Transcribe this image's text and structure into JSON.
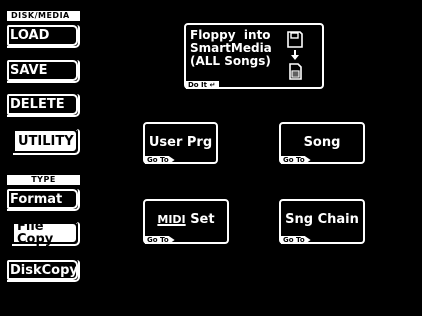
{
  "sidebar": {
    "header": "DISK/MEDIA",
    "items": [
      {
        "label": "LOAD"
      },
      {
        "label": "SAVE"
      },
      {
        "label": "DELETE"
      },
      {
        "label": "UTILITY"
      }
    ],
    "type_header": "TYPE",
    "type_items": [
      {
        "label": "Format"
      },
      {
        "label": "File Copy"
      },
      {
        "label": "DiskCopy"
      }
    ]
  },
  "operation": {
    "line1": "Floppy  into",
    "line2": "SmartMedia",
    "line3": "(ALL Songs)",
    "doit": "Do It ↵"
  },
  "panels": [
    {
      "label": "User Prg",
      "goto": "Go To"
    },
    {
      "label": "Song",
      "goto": "Go To"
    },
    {
      "label": "Set",
      "prefix": "MIDI",
      "goto": "Go To"
    },
    {
      "label": "Sng Chain",
      "goto": "Go To"
    }
  ],
  "icons": {
    "source": "floppy-disk-icon",
    "arrow": "arrow-down-icon",
    "target": "smartmedia-card-icon"
  }
}
